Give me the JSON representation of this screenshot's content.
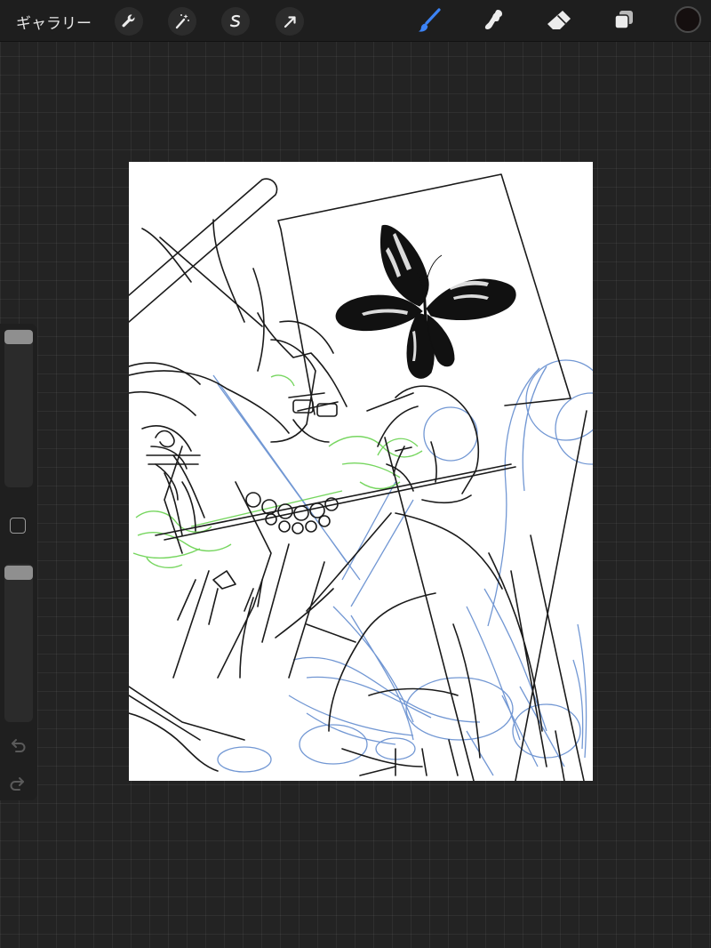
{
  "toolbar": {
    "gallery_label": "ギャラリー",
    "left_tools": [
      "wrench-icon",
      "magic-wand-icon",
      "selection-icon",
      "transform-arrow-icon"
    ],
    "right_tools": [
      "brush-icon",
      "smudge-icon",
      "eraser-icon",
      "layers-icon"
    ],
    "active_tool": "brush-icon",
    "accent_color": "#3c83f5",
    "current_color": "#150f0f"
  },
  "sidebar": {
    "controls": [
      "brush-size-slider",
      "modify-button",
      "opacity-slider",
      "undo-icon",
      "redo-icon"
    ]
  },
  "canvas": {
    "background": "#ffffff",
    "sketch_colors": {
      "ink": "#1a1a1a",
      "blue_pencil": "#4f7ec9",
      "green_pencil": "#5fcf44"
    }
  }
}
